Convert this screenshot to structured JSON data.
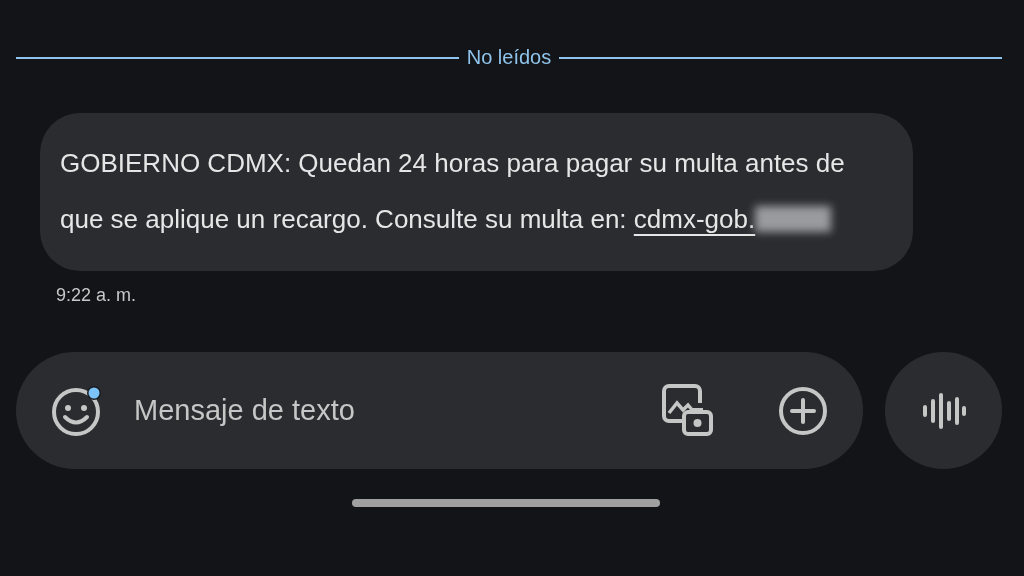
{
  "divider": {
    "label": "No leídos"
  },
  "message": {
    "text": "GOBIERNO CDMX: Quedan 24 horas para pagar su multa antes de que se aplique un recargo. Consulte su multa en:",
    "link": "cdmx-gob.",
    "link_redacted": true,
    "time": "9:22 a. m."
  },
  "composer": {
    "placeholder": "Mensaje de texto"
  }
}
